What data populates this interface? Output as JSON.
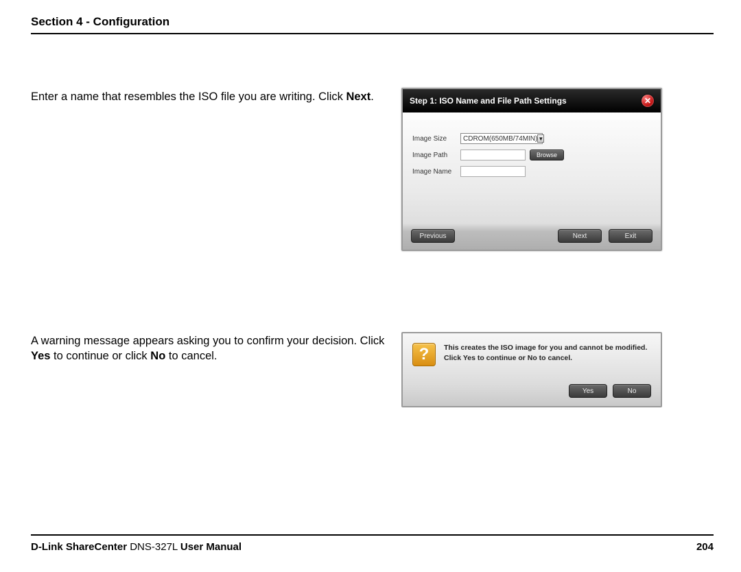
{
  "header": {
    "section_title": "Section 4 - Configuration"
  },
  "row1": {
    "instruction_pre": "Enter a name that resembles the ISO file you are writing. Click ",
    "instruction_bold": "Next",
    "instruction_post": "."
  },
  "dialog1": {
    "title": "Step 1: ISO Name and File Path Settings",
    "labels": {
      "image_size": "Image Size",
      "image_path": "Image Path",
      "image_name": "Image Name"
    },
    "image_size_value": "CDROM(650MB/74MIN)",
    "browse": "Browse",
    "previous": "Previous",
    "next": "Next",
    "exit": "Exit"
  },
  "row2": {
    "instruction_pre": "A warning message appears asking you to confirm your decision. Click ",
    "bold1": "Yes",
    "mid": " to continue or click ",
    "bold2": "No",
    "post": " to cancel."
  },
  "dialog2": {
    "line1": "This creates the ISO image for you and cannot be modified.",
    "line2": "Click Yes to continue or No to cancel.",
    "yes": "Yes",
    "no": "No"
  },
  "footer": {
    "brand_bold1": "D-Link ShareCenter",
    "model": " DNS-327L ",
    "brand_bold2": "User Manual",
    "page": "204"
  }
}
